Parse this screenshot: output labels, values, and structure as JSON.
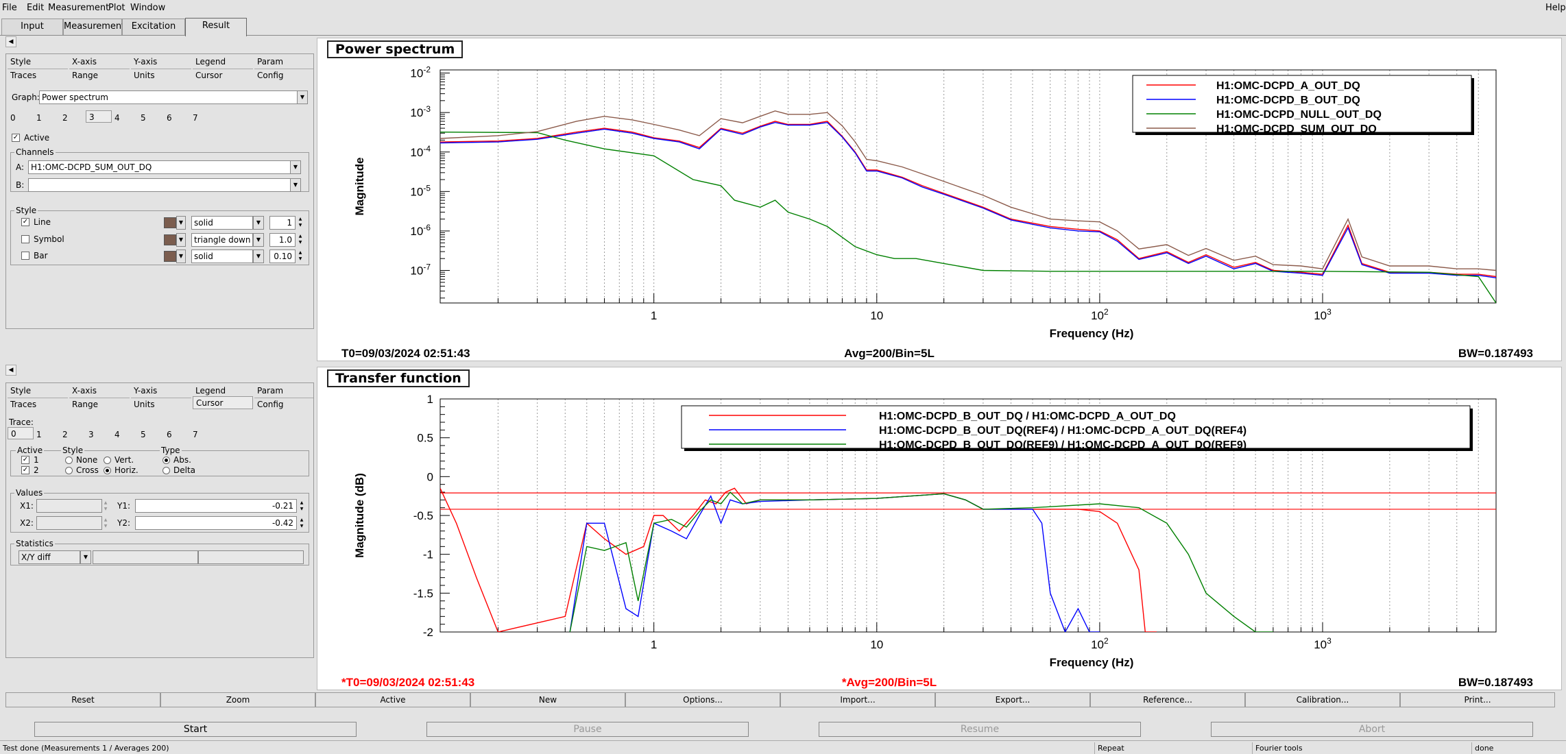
{
  "menu": {
    "file": "File",
    "edit": "Edit",
    "measurement": "Measurement",
    "plot": "Plot",
    "window": "Window",
    "help": "Help"
  },
  "top_tabs": [
    "Input",
    "Measurement",
    "Excitation",
    "Result"
  ],
  "panel1": {
    "subtabs_row1": [
      "Style",
      "X-axis",
      "Y-axis",
      "Legend",
      "Param"
    ],
    "subtabs_row2": [
      "Traces",
      "Range",
      "Units",
      "Cursor",
      "Config"
    ],
    "graph_label": "Graph:",
    "graph_value": "Power spectrum",
    "trace_tabs": [
      "0",
      "1",
      "2",
      "3",
      "4",
      "5",
      "6",
      "7"
    ],
    "active_label": "Active",
    "channels_title": "Channels",
    "a_label": "A:",
    "a_value": "H1:OMC-DCPD_SUM_OUT_DQ",
    "b_label": "B:",
    "b_value": "",
    "style_title": "Style",
    "line_label": "Line",
    "line_style": "solid",
    "line_width": "1",
    "symbol_label": "Symbol",
    "symbol_style": "triangle down",
    "symbol_size": "1.0",
    "bar_label": "Bar",
    "bar_style": "solid",
    "bar_width": "0.10"
  },
  "panel2": {
    "subtabs_row1": [
      "Style",
      "X-axis",
      "Y-axis",
      "Legend",
      "Param"
    ],
    "subtabs_row2": [
      "Traces",
      "Range",
      "Units",
      "Cursor",
      "Config"
    ],
    "trace_label": "Trace:",
    "trace_tabs": [
      "0",
      "1",
      "2",
      "3",
      "4",
      "5",
      "6",
      "7"
    ],
    "active_title": "Active",
    "active1": "1",
    "active2": "2",
    "style_title": "Style",
    "none_label": "None",
    "vert_label": "Vert.",
    "cross_label": "Cross",
    "horiz_label": "Horiz.",
    "type_title": "Type",
    "abs_label": "Abs.",
    "delta_label": "Delta",
    "values_title": "Values",
    "x1_label": "X1:",
    "y1_label": "Y1:",
    "y1_value": "-0.21",
    "x2_label": "X2:",
    "y2_label": "Y2:",
    "y2_value": "-0.42",
    "statistics_title": "Statistics",
    "stats_value": "X/Y diff"
  },
  "plot1": {
    "title": "Power spectrum",
    "ylabel": "Magnitude",
    "xlabel": "Frequency (Hz)",
    "t0": "T0=09/03/2024 02:51:43",
    "avg": "Avg=200/Bin=5L",
    "bw": "BW=0.187493",
    "legend": [
      "H1:OMC-DCPD_A_OUT_DQ",
      "H1:OMC-DCPD_B_OUT_DQ",
      "H1:OMC-DCPD_NULL_OUT_DQ",
      "H1:OMC-DCPD_SUM_OUT_DQ"
    ]
  },
  "plot2": {
    "title": "Transfer function",
    "ylabel": "Magnitude (dB)",
    "xlabel": "Frequency (Hz)",
    "t0": "*T0=09/03/2024 02:51:43",
    "avg": "*Avg=200/Bin=5L",
    "bw": "BW=0.187493",
    "legend": [
      "H1:OMC-DCPD_B_OUT_DQ / H1:OMC-DCPD_A_OUT_DQ",
      "H1:OMC-DCPD_B_OUT_DQ(REF4) / H1:OMC-DCPD_A_OUT_DQ(REF4)",
      "H1:OMC-DCPD_B_OUT_DQ(REF9) / H1:OMC-DCPD_A_OUT_DQ(REF9)"
    ]
  },
  "buttons": [
    "Reset",
    "Zoom",
    "Active",
    "New",
    "Options...",
    "Import...",
    "Export...",
    "Reference...",
    "Calibration...",
    "Print..."
  ],
  "control": {
    "start": "Start",
    "pause": "Pause",
    "resume": "Resume",
    "abort": "Abort"
  },
  "status": {
    "message": "Test done (Measurements 1 / Averages 200)",
    "repeat": "Repeat",
    "tools": "Fourier tools",
    "state": "done"
  },
  "colors": {
    "a": "#ff0000",
    "b": "#0000ff",
    "null": "#008000",
    "sum": "#8b5a4a",
    "trace_swatch": "#7b5d4e",
    "red_text": "#ff0000"
  },
  "chart_data": [
    {
      "type": "line",
      "title": "Power spectrum",
      "xlabel": "Frequency (Hz)",
      "ylabel": "Magnitude",
      "xscale": "log",
      "yscale": "log",
      "xlim": [
        0.11,
        6000
      ],
      "ylim": [
        1.5e-08,
        0.012
      ],
      "x_ticks": [
        "1",
        "10",
        "10^2",
        "10^3"
      ],
      "y_ticks": [
        "10^-7",
        "10^-6",
        "10^-5",
        "10^-4",
        "10^-3",
        "10^-2"
      ],
      "grid": true,
      "legend_position": "top-right",
      "series": [
        {
          "name": "H1:OMC-DCPD_A_OUT_DQ",
          "color": "#ff0000",
          "x": [
            0.11,
            0.2,
            0.3,
            0.45,
            0.6,
            0.8,
            1.0,
            1.3,
            1.6,
            2,
            2.5,
            3,
            3.5,
            4,
            5,
            6,
            7,
            8,
            9,
            10,
            13,
            16,
            20,
            30,
            40,
            60,
            80,
            100,
            120,
            150,
            200,
            250,
            300,
            400,
            500,
            600,
            800,
            1000,
            1300,
            1500,
            2000,
            3000,
            4000,
            5000,
            6000
          ],
          "y": [
            0.00018,
            0.00019,
            0.00022,
            0.00032,
            0.0004,
            0.00032,
            0.00023,
            0.00019,
            0.00013,
            0.0004,
            0.0003,
            0.00045,
            0.0006,
            0.0005,
            0.0005,
            0.0006,
            0.00025,
            0.0001,
            3.5e-05,
            3.5e-05,
            2.3e-05,
            1.4e-05,
            9e-06,
            4e-06,
            2e-06,
            1.3e-06,
            1.1e-06,
            1e-06,
            6e-07,
            2e-07,
            3e-07,
            1.6e-07,
            2.5e-07,
            1.2e-07,
            1.6e-07,
            1e-07,
            9e-08,
            8e-08,
            1.4e-06,
            1.5e-07,
            9e-08,
            9e-08,
            8e-08,
            8e-08,
            7e-08
          ]
        },
        {
          "name": "H1:OMC-DCPD_B_OUT_DQ",
          "color": "#0000ff",
          "x": [
            0.11,
            0.2,
            0.3,
            0.45,
            0.6,
            0.8,
            1.0,
            1.3,
            1.6,
            2,
            2.5,
            3,
            3.5,
            4,
            5,
            6,
            7,
            8,
            9,
            10,
            13,
            16,
            20,
            30,
            40,
            60,
            80,
            100,
            120,
            150,
            200,
            250,
            300,
            400,
            500,
            600,
            800,
            1000,
            1300,
            1500,
            2000,
            3000,
            4000,
            5000,
            6000
          ],
          "y": [
            0.00017,
            0.00018,
            0.00021,
            0.0003,
            0.00038,
            0.0003,
            0.00022,
            0.00018,
            0.00012,
            0.00038,
            0.00028,
            0.00043,
            0.00056,
            0.00048,
            0.00048,
            0.00056,
            0.00024,
            9.5e-05,
            3.3e-05,
            3.3e-05,
            2.2e-05,
            1.3e-05,
            8.5e-06,
            3.8e-06,
            1.9e-06,
            1.2e-06,
            1e-06,
            9.5e-07,
            5.5e-07,
            1.9e-07,
            2.8e-07,
            1.5e-07,
            2.3e-07,
            1.1e-07,
            1.5e-07,
            9.5e-08,
            8.5e-08,
            7.5e-08,
            1.2e-06,
            1.4e-07,
            8.5e-08,
            8.5e-08,
            7.5e-08,
            7.5e-08,
            6.5e-08
          ]
        },
        {
          "name": "H1:OMC-DCPD_NULL_OUT_DQ",
          "color": "#008000",
          "x": [
            0.11,
            0.3,
            0.4,
            0.6,
            1.0,
            1.5,
            2,
            2.3,
            3,
            3.5,
            4,
            5,
            6,
            8,
            10,
            12,
            15,
            20,
            30,
            60,
            100,
            300,
            1000,
            3000,
            5000,
            6000
          ],
          "y": [
            0.00032,
            0.00031,
            0.0002,
            0.00012,
            8e-05,
            2e-05,
            1.4e-05,
            6e-06,
            4e-06,
            6e-06,
            3e-06,
            2e-06,
            1.3e-06,
            4e-07,
            2.5e-07,
            2e-07,
            2e-07,
            1.5e-07,
            1e-07,
            9.5e-08,
            9.5e-08,
            9.5e-08,
            9.5e-08,
            9e-08,
            7e-08,
            1.5e-08
          ]
        },
        {
          "name": "H1:OMC-DCPD_SUM_OUT_DQ",
          "color": "#8b5a4a",
          "x": [
            0.11,
            0.2,
            0.3,
            0.45,
            0.6,
            0.8,
            1.0,
            1.3,
            1.6,
            2,
            2.5,
            3,
            3.5,
            4,
            5,
            6,
            7,
            8,
            9,
            10,
            13,
            16,
            20,
            30,
            40,
            60,
            80,
            100,
            120,
            150,
            200,
            250,
            300,
            400,
            500,
            600,
            800,
            1000,
            1300,
            1500,
            2000,
            3000,
            4000,
            5000,
            6000
          ],
          "y": [
            0.00022,
            0.00026,
            0.00033,
            0.0006,
            0.0008,
            0.00065,
            0.0005,
            0.00036,
            0.00026,
            0.0007,
            0.00055,
            0.0008,
            0.0011,
            0.0009,
            0.0009,
            0.001,
            0.00046,
            0.00018,
            6.5e-05,
            6e-05,
            4.2e-05,
            2.8e-05,
            1.8e-05,
            8e-06,
            4e-06,
            2e-06,
            1.8e-06,
            1.7e-06,
            1e-06,
            3.5e-07,
            4.5e-07,
            2.4e-07,
            3.6e-07,
            1.8e-07,
            2.3e-07,
            1.4e-07,
            1.3e-07,
            1.1e-07,
            2e-06,
            2.2e-07,
            1.3e-07,
            1.3e-07,
            1.1e-07,
            1.1e-07,
            1e-07
          ]
        }
      ]
    },
    {
      "type": "line",
      "title": "Transfer function",
      "xlabel": "Frequency (Hz)",
      "ylabel": "Magnitude (dB)",
      "xscale": "log",
      "yscale": "linear",
      "xlim": [
        0.11,
        6000
      ],
      "ylim": [
        -2,
        1
      ],
      "x_ticks": [
        "1",
        "10",
        "10^2",
        "10^3"
      ],
      "y_ticks": [
        "-2",
        "-1.5",
        "-1",
        "-0.5",
        "0",
        "0.5",
        "1"
      ],
      "grid": true,
      "legend_position": "top",
      "cursor_lines": [
        -0.21,
        -0.42
      ],
      "series": [
        {
          "name": "H1:OMC-DCPD_B_OUT_DQ / H1:OMC-DCPD_A_OUT_DQ",
          "color": "#ff0000",
          "x": [
            0.11,
            0.13,
            0.16,
            0.2,
            0.4,
            0.5,
            0.6,
            0.75,
            0.9,
            1.0,
            1.1,
            1.3,
            1.5,
            1.7,
            1.9,
            2.1,
            2.3,
            2.6,
            3,
            5,
            10,
            20,
            25,
            30,
            50,
            60,
            80,
            100,
            120,
            150,
            160,
            180
          ],
          "y": [
            -0.15,
            -0.6,
            -1.3,
            -2,
            -1.8,
            -0.6,
            -0.8,
            -1.0,
            -0.9,
            -0.5,
            -0.5,
            -0.7,
            -0.5,
            -0.3,
            -0.35,
            -0.2,
            -0.15,
            -0.35,
            -0.3,
            -0.3,
            -0.28,
            -0.22,
            -0.3,
            -0.42,
            -0.42,
            -0.42,
            -0.42,
            -0.45,
            -0.6,
            -1.2,
            -2,
            -2
          ]
        },
        {
          "name": "H1:OMC-DCPD_B_OUT_DQ(REF4) / H1:OMC-DCPD_A_OUT_DQ(REF4)",
          "color": "#0000ff",
          "x": [
            0.42,
            0.5,
            0.6,
            0.75,
            0.85,
            1.0,
            1.2,
            1.4,
            1.6,
            1.8,
            2.0,
            2.2,
            2.5,
            3,
            5,
            10,
            20,
            25,
            30,
            50,
            55,
            60,
            70,
            80,
            90,
            100
          ],
          "y": [
            -2,
            -0.6,
            -0.6,
            -1.7,
            -1.8,
            -0.6,
            -0.7,
            -0.8,
            -0.5,
            -0.25,
            -0.6,
            -0.3,
            -0.35,
            -0.32,
            -0.3,
            -0.28,
            -0.22,
            -0.3,
            -0.42,
            -0.42,
            -0.6,
            -1.5,
            -2,
            -1.7,
            -2,
            -2
          ]
        },
        {
          "name": "H1:OMC-DCPD_B_OUT_DQ(REF9) / H1:OMC-DCPD_A_OUT_DQ(REF9)",
          "color": "#008000",
          "x": [
            0.42,
            0.5,
            0.6,
            0.75,
            0.85,
            1.0,
            1.2,
            1.4,
            1.6,
            1.8,
            2.0,
            2.2,
            2.5,
            3,
            5,
            10,
            20,
            25,
            30,
            50,
            100,
            150,
            200,
            250,
            300,
            400,
            500,
            600
          ],
          "y": [
            -2,
            -0.9,
            -0.95,
            -0.85,
            -1.6,
            -0.6,
            -0.55,
            -0.65,
            -0.45,
            -0.3,
            -0.35,
            -0.2,
            -0.35,
            -0.3,
            -0.3,
            -0.28,
            -0.22,
            -0.3,
            -0.42,
            -0.4,
            -0.35,
            -0.4,
            -0.6,
            -1.0,
            -1.5,
            -1.8,
            -2,
            -2
          ]
        }
      ]
    }
  ]
}
